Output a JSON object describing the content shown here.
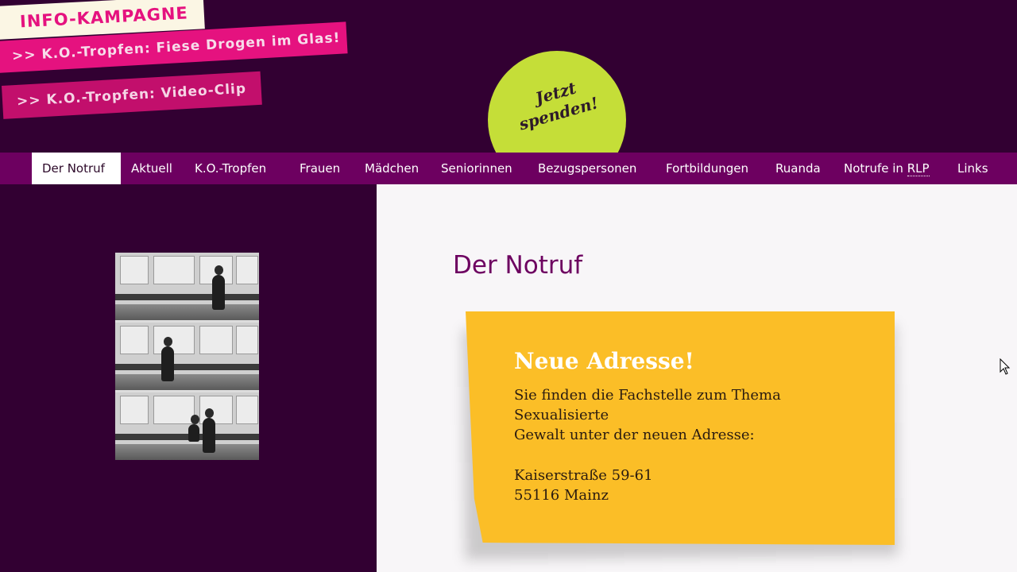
{
  "header": {
    "campaign_label": "INFO-KAMPAGNE",
    "link_drugs": ">> K.O.-Tropfen: Fiese Drogen im Glas!",
    "link_video": ">> K.O.-Tropfen: Video-Clip",
    "donate_line1": "Jetzt",
    "donate_line2": "spenden!"
  },
  "nav": {
    "items": [
      {
        "label": "Der Notruf",
        "active": true
      },
      {
        "label": "Aktuell"
      },
      {
        "label": "K.O.-Tropfen"
      },
      {
        "label": "Frauen"
      },
      {
        "label": "Mädchen"
      },
      {
        "label": "Seniorinnen"
      },
      {
        "label": "Bezugspersonen"
      },
      {
        "label": "Fortbildungen"
      },
      {
        "label": "Ruanda"
      },
      {
        "label": "Notrufe in",
        "abbr": "RLP"
      },
      {
        "label": "Links"
      }
    ]
  },
  "main": {
    "title": "Der Notruf",
    "note": {
      "heading": "Neue Adresse!",
      "text_line1": "Sie finden die Fachstelle zum Thema Sexualisierte",
      "text_line2": "Gewalt unter der neuen Adresse:",
      "street": "Kaiserstraße 59-61",
      "city": "55116 Mainz"
    }
  },
  "colors": {
    "background": "#320032",
    "nav": "#6d0060",
    "pink": "#e5127f",
    "lime": "#c5de38",
    "note": "#fbbe27"
  }
}
